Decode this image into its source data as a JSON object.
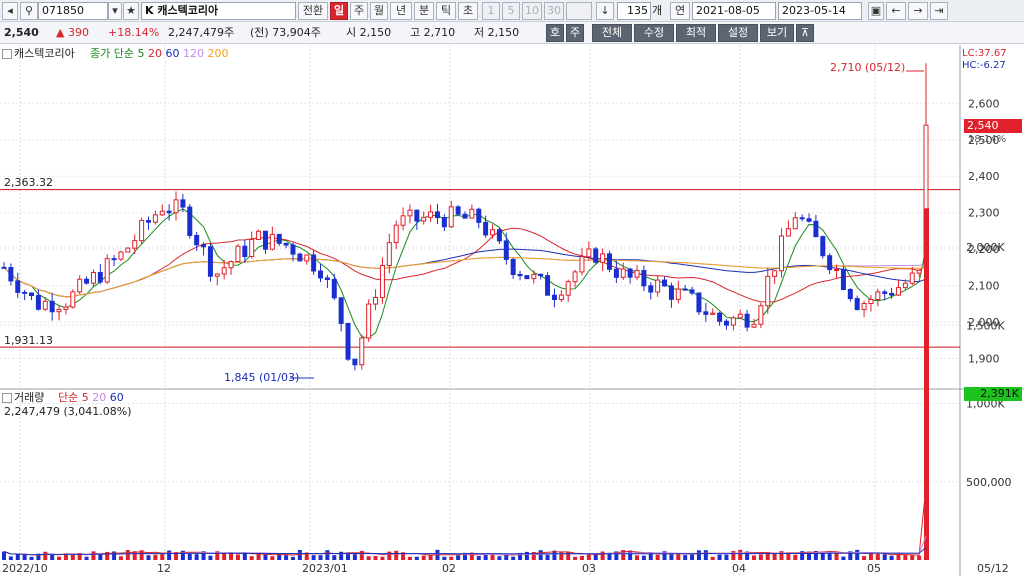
{
  "toolbar": {
    "code": "071850",
    "stock_name": "K 캐스텍코리아",
    "convert_label": "전환",
    "periods": [
      "일",
      "주",
      "월",
      "년",
      "분",
      "틱",
      "초"
    ],
    "active_period": "일",
    "minute_options": [
      "1",
      "5",
      "10",
      "30"
    ],
    "count_value": "135",
    "count_unit": "개",
    "year_label": "연",
    "date_from": "2021-08-05",
    "date_to": "2023-05-14"
  },
  "quote": {
    "price": "2,540",
    "change": "▲ 390",
    "change_pct": "+18.14%",
    "volume": "2,247,479주",
    "prev_label": "(전) 73,904주",
    "open": "시 2,150",
    "high": "고 2,710",
    "low": "저 2,150"
  },
  "toolbar2": {
    "buttons": [
      "호",
      "주",
      "전체",
      "수정",
      "최적",
      "설정",
      "보기"
    ]
  },
  "chart_data": [
    {
      "type": "candlestick",
      "title": "캐스텍코리아",
      "legend": [
        "종가 단순 5",
        "20",
        "60",
        "120",
        "200"
      ],
      "legend_colors": [
        "#1a8a1a",
        "#d8262f",
        "#1a2fb5",
        "#c48be0",
        "#f0a020"
      ],
      "x_labels": [
        "2022/10",
        "12",
        "2023/01",
        "02",
        "03",
        "04",
        "05",
        "05/12"
      ],
      "y_ticks": [
        1900,
        2000,
        2100,
        2200,
        2300,
        2400,
        2500,
        2600
      ],
      "ylim": [
        1860,
        2720
      ],
      "hlines": [
        2363.32,
        1931.13
      ],
      "hline_labels": [
        "2,363.32",
        "1,931.13"
      ],
      "annotations": [
        "2,710 (05/12)",
        "1,845 (01/03)"
      ],
      "current_label": "2,540",
      "current_pct": "18.14%",
      "lc": "LC:37.67",
      "hc": "HC:-6.27",
      "last_bar": {
        "open": 2150,
        "high": 2710,
        "low": 2150,
        "close": 2540
      }
    },
    {
      "type": "bar",
      "title": "거래량",
      "legend": [
        "단순 5",
        "20",
        "60"
      ],
      "legend_colors": [
        "#d8262f",
        "#c48be0",
        "#1a2fb5"
      ],
      "info": "2,247,479 (3,041.08%)",
      "y_ticks_labels": [
        "500,000",
        "1,000K",
        "1,500K",
        "2,000K"
      ],
      "y_ticks": [
        500000,
        1000000,
        1500000,
        2000000
      ],
      "current_label": "2,391K",
      "last_value": 2247479
    }
  ],
  "colors": {
    "up": "#e0202a",
    "down": "#1a2fd0",
    "hline": "#c8141c"
  }
}
